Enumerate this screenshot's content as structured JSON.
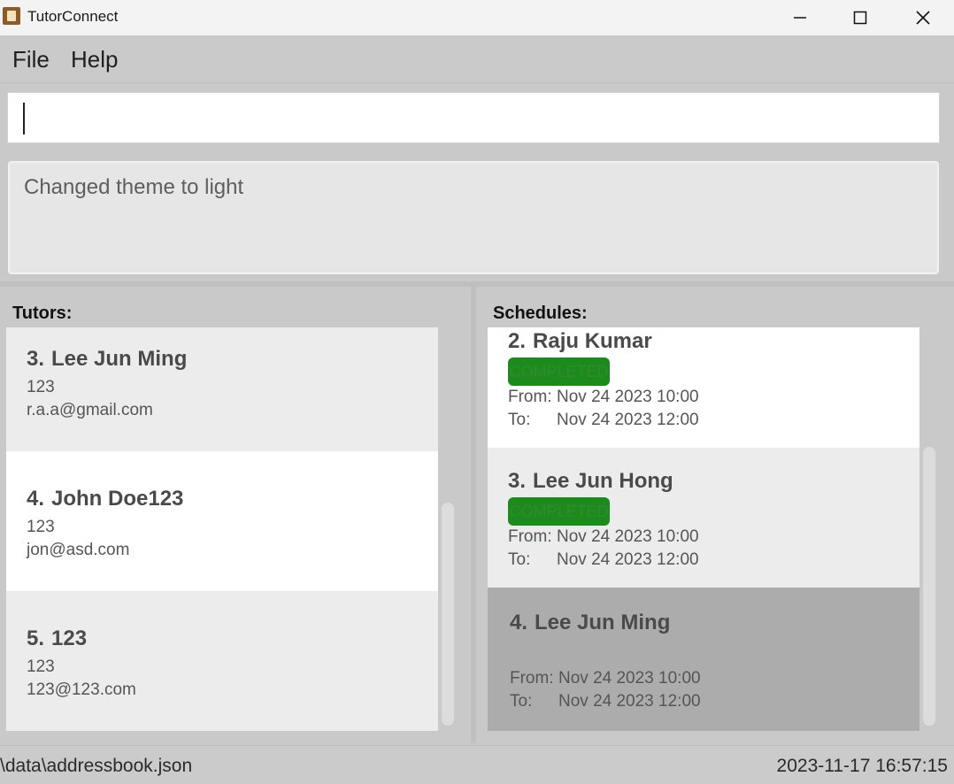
{
  "window": {
    "title": "TutorConnect"
  },
  "menu": {
    "file": "File",
    "help": "Help"
  },
  "command": {
    "value": ""
  },
  "result": {
    "message": "Changed theme to light"
  },
  "tutors": {
    "label": "Tutors:",
    "items": [
      {
        "index": "3.",
        "name": "Lee Jun Ming",
        "phone": "123",
        "email": "r.a.a@gmail.com"
      },
      {
        "index": "4.",
        "name": "John Doe123",
        "phone": "123",
        "email": "jon@asd.com"
      },
      {
        "index": "5.",
        "name": "123",
        "phone": "123",
        "email": "123@123.com"
      }
    ]
  },
  "schedules": {
    "label": "Schedules:",
    "from_label": "From:",
    "to_label": "To:",
    "items": [
      {
        "index": "2.",
        "name": "Raju Kumar",
        "status": "COMPLETED",
        "from": "Nov 24 2023 10:00",
        "to": "Nov 24 2023 12:00"
      },
      {
        "index": "3.",
        "name": "Lee Jun Hong",
        "status": "COMPLETED",
        "from": "Nov 24 2023 10:00",
        "to": "Nov 24 2023 12:00"
      },
      {
        "index": "4.",
        "name": "Lee Jun Ming",
        "status": "",
        "from": "Nov 24 2023 10:00",
        "to": "Nov 24 2023 12:00"
      }
    ]
  },
  "status": {
    "file_path": "\\data\\addressbook.json",
    "timestamp": "2023-11-17 16:57:15"
  },
  "colors": {
    "badge_completed": "#1b8c1b",
    "selected_card": "#acacac"
  }
}
